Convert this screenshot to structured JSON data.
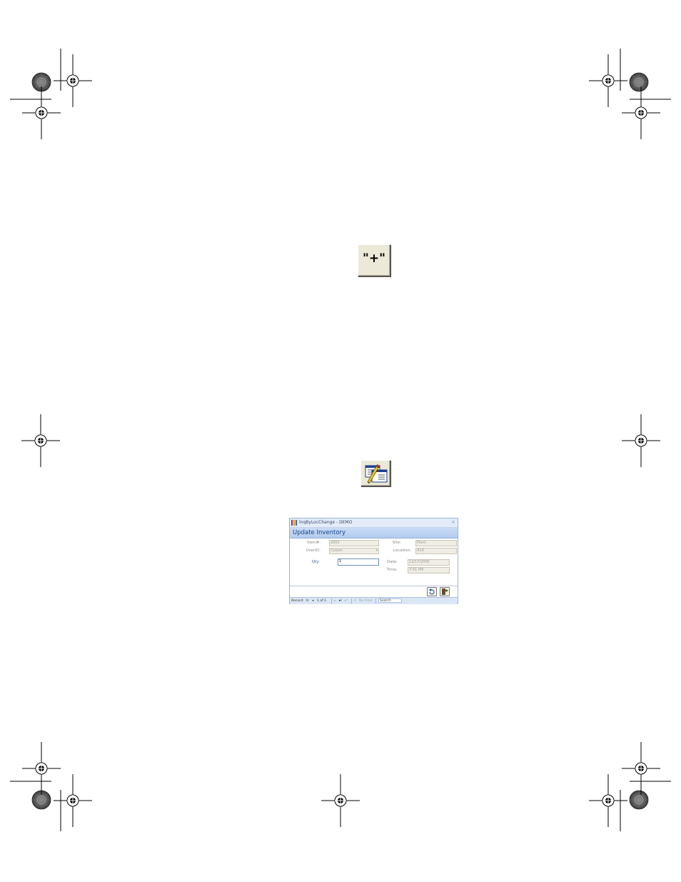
{
  "toolbar_buttons": {
    "paste_quote_icon": "quote-plus-icon",
    "plus_button_glyph": "\"+\"",
    "edit_icon": "form-edit-pencil-icon"
  },
  "window": {
    "title": "lnqByLocChange - DEMO",
    "close_glyph": "×",
    "form_title": "Update Inventory",
    "fields": {
      "item_label": "Item#:",
      "item_value": "2001",
      "site_label": "Site:",
      "site_value": "Plant",
      "userid_label": "UserID:",
      "userid_value": "Colson",
      "location_label": "Location:",
      "location_value": "A1A",
      "qty_label": "Qty:",
      "qty_value": "1",
      "date_label": "Date:",
      "date_value": "12/17/2005",
      "time_label": "Time:",
      "time_value": "7:51 PM"
    },
    "buttons": {
      "undo_icon": "undo-icon",
      "exit_icon": "exit-door-icon"
    },
    "navbar": {
      "record_label": "Record:",
      "first": "H",
      "prev": "◂",
      "position": "1 of 1",
      "next": "▸",
      "last": "▸I",
      "new": "▸*",
      "filter": "No Filter",
      "search": "Search"
    }
  }
}
